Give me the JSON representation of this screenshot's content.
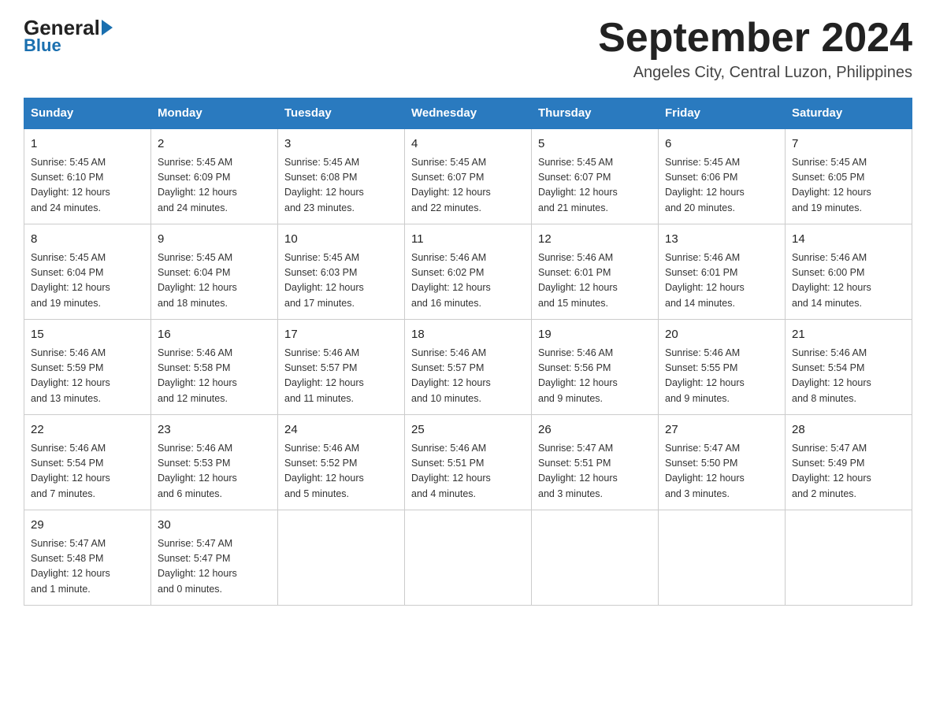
{
  "header": {
    "logo_general": "General",
    "logo_blue": "Blue",
    "month_title": "September 2024",
    "location": "Angeles City, Central Luzon, Philippines"
  },
  "days_of_week": [
    "Sunday",
    "Monday",
    "Tuesday",
    "Wednesday",
    "Thursday",
    "Friday",
    "Saturday"
  ],
  "weeks": [
    [
      {
        "day": "1",
        "sunrise": "5:45 AM",
        "sunset": "6:10 PM",
        "daylight": "12 hours and 24 minutes."
      },
      {
        "day": "2",
        "sunrise": "5:45 AM",
        "sunset": "6:09 PM",
        "daylight": "12 hours and 24 minutes."
      },
      {
        "day": "3",
        "sunrise": "5:45 AM",
        "sunset": "6:08 PM",
        "daylight": "12 hours and 23 minutes."
      },
      {
        "day": "4",
        "sunrise": "5:45 AM",
        "sunset": "6:07 PM",
        "daylight": "12 hours and 22 minutes."
      },
      {
        "day": "5",
        "sunrise": "5:45 AM",
        "sunset": "6:07 PM",
        "daylight": "12 hours and 21 minutes."
      },
      {
        "day": "6",
        "sunrise": "5:45 AM",
        "sunset": "6:06 PM",
        "daylight": "12 hours and 20 minutes."
      },
      {
        "day": "7",
        "sunrise": "5:45 AM",
        "sunset": "6:05 PM",
        "daylight": "12 hours and 19 minutes."
      }
    ],
    [
      {
        "day": "8",
        "sunrise": "5:45 AM",
        "sunset": "6:04 PM",
        "daylight": "12 hours and 19 minutes."
      },
      {
        "day": "9",
        "sunrise": "5:45 AM",
        "sunset": "6:04 PM",
        "daylight": "12 hours and 18 minutes."
      },
      {
        "day": "10",
        "sunrise": "5:45 AM",
        "sunset": "6:03 PM",
        "daylight": "12 hours and 17 minutes."
      },
      {
        "day": "11",
        "sunrise": "5:46 AM",
        "sunset": "6:02 PM",
        "daylight": "12 hours and 16 minutes."
      },
      {
        "day": "12",
        "sunrise": "5:46 AM",
        "sunset": "6:01 PM",
        "daylight": "12 hours and 15 minutes."
      },
      {
        "day": "13",
        "sunrise": "5:46 AM",
        "sunset": "6:01 PM",
        "daylight": "12 hours and 14 minutes."
      },
      {
        "day": "14",
        "sunrise": "5:46 AM",
        "sunset": "6:00 PM",
        "daylight": "12 hours and 14 minutes."
      }
    ],
    [
      {
        "day": "15",
        "sunrise": "5:46 AM",
        "sunset": "5:59 PM",
        "daylight": "12 hours and 13 minutes."
      },
      {
        "day": "16",
        "sunrise": "5:46 AM",
        "sunset": "5:58 PM",
        "daylight": "12 hours and 12 minutes."
      },
      {
        "day": "17",
        "sunrise": "5:46 AM",
        "sunset": "5:57 PM",
        "daylight": "12 hours and 11 minutes."
      },
      {
        "day": "18",
        "sunrise": "5:46 AM",
        "sunset": "5:57 PM",
        "daylight": "12 hours and 10 minutes."
      },
      {
        "day": "19",
        "sunrise": "5:46 AM",
        "sunset": "5:56 PM",
        "daylight": "12 hours and 9 minutes."
      },
      {
        "day": "20",
        "sunrise": "5:46 AM",
        "sunset": "5:55 PM",
        "daylight": "12 hours and 9 minutes."
      },
      {
        "day": "21",
        "sunrise": "5:46 AM",
        "sunset": "5:54 PM",
        "daylight": "12 hours and 8 minutes."
      }
    ],
    [
      {
        "day": "22",
        "sunrise": "5:46 AM",
        "sunset": "5:54 PM",
        "daylight": "12 hours and 7 minutes."
      },
      {
        "day": "23",
        "sunrise": "5:46 AM",
        "sunset": "5:53 PM",
        "daylight": "12 hours and 6 minutes."
      },
      {
        "day": "24",
        "sunrise": "5:46 AM",
        "sunset": "5:52 PM",
        "daylight": "12 hours and 5 minutes."
      },
      {
        "day": "25",
        "sunrise": "5:46 AM",
        "sunset": "5:51 PM",
        "daylight": "12 hours and 4 minutes."
      },
      {
        "day": "26",
        "sunrise": "5:47 AM",
        "sunset": "5:51 PM",
        "daylight": "12 hours and 3 minutes."
      },
      {
        "day": "27",
        "sunrise": "5:47 AM",
        "sunset": "5:50 PM",
        "daylight": "12 hours and 3 minutes."
      },
      {
        "day": "28",
        "sunrise": "5:47 AM",
        "sunset": "5:49 PM",
        "daylight": "12 hours and 2 minutes."
      }
    ],
    [
      {
        "day": "29",
        "sunrise": "5:47 AM",
        "sunset": "5:48 PM",
        "daylight": "12 hours and 1 minute."
      },
      {
        "day": "30",
        "sunrise": "5:47 AM",
        "sunset": "5:47 PM",
        "daylight": "12 hours and 0 minutes."
      },
      null,
      null,
      null,
      null,
      null
    ]
  ],
  "labels": {
    "sunrise": "Sunrise:",
    "sunset": "Sunset:",
    "daylight": "Daylight:"
  }
}
